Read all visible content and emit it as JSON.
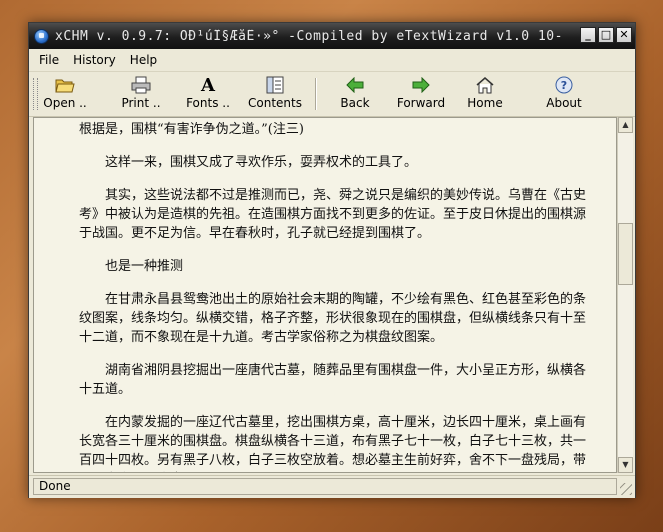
{
  "window": {
    "title": "xCHM v. 0.9.7: ÕÐ¹úÎ§ÆåÊ·»°  -Compiled by eTextWizard v1.0  10-",
    "minimize_label": "_",
    "maximize_label": "□",
    "close_label": "✕"
  },
  "menu": [
    {
      "label": "File",
      "name": "menu-file"
    },
    {
      "label": "History",
      "name": "menu-history"
    },
    {
      "label": "Help",
      "name": "menu-help"
    }
  ],
  "toolbar": {
    "open": "Open ..",
    "print": "Print ..",
    "fonts": "Fonts ..",
    "contents": "Contents",
    "back": "Back",
    "forward": "Forward",
    "home": "Home",
    "about": "About",
    "fonts_glyph": "A"
  },
  "content": {
    "paragraphs": [
      "根据是，围棋“有害诈争伪之道。”(注三)",
      "这样一来，围棋又成了寻欢作乐，耍弄权术的工具了。",
      "其实，这些说法都不过是推测而已，尧、舜之说只是编织的美妙传说。乌曹在《古史考》中被认为是造棋的先祖。在造围棋方面找不到更多的佐证。至于皮日休提出的围棋源于战国。更不足为信。早在春秋时，孔子就已经提到围棋了。",
      "也是一种推测",
      "在甘肃永昌县鸳鸯池出土的原始社会末期的陶罐，不少绘有黑色、红色甚至彩色的条纹图案，线条均匀。纵横交错，格子齐整，形状很象现在的围棋盘，但纵横线条只有十至十二道，而不象现在是十九道。考古学家俗称之为棋盘纹图案。",
      "湖南省湘阴县挖掘出一座唐代古墓，随葬品里有围棋盘一件，大小呈正方形，纵横各十五道。",
      "在内蒙发掘的一座辽代古墓里，挖出围棋方桌，高十厘米，边长四十厘米，桌上画有长宽各三十厘米的围棋盘。棋盘纵横各十三道，布有黑子七十一枚，白子七十三枚，共一百四十四枚。另有黑子八枚，白子三枚空放着。想必墓主生前好弈，舍不下一盘残局，带到九泉之下琢磨去了。"
    ]
  },
  "status": {
    "text": "Done"
  }
}
